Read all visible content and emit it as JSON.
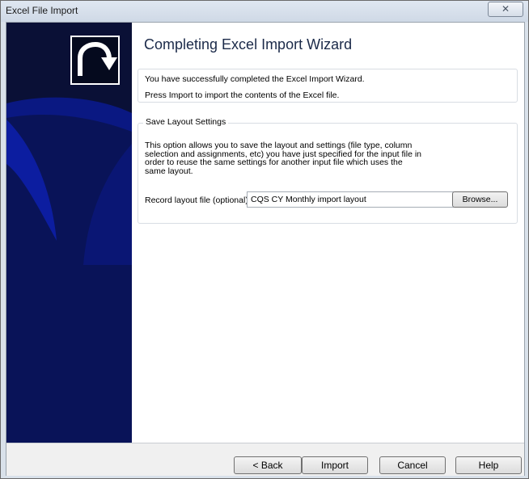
{
  "window": {
    "title": "Excel File Import",
    "close_glyph": "✕"
  },
  "wizard": {
    "heading": "Completing Excel Import Wizard",
    "logo_icon": "curved-arrow-icon",
    "side_panel_color": "#0a1036",
    "accent_color": "#0b1a8f"
  },
  "info": {
    "line1": "You have successfully completed the Excel Import Wizard.",
    "line2": "Press Import to import the contents of the Excel file."
  },
  "layout_settings": {
    "legend": "Save Layout Settings",
    "description": "This option allows you to save the layout and settings (file type, column selection and assignments, etc) you have just specified for the input file in order to reuse the same settings for another input file which uses the same layout.",
    "field_label": "Record layout file (optional):",
    "field_value": "CQS CY Monthly import layout",
    "browse_label": "Browse..."
  },
  "buttons": {
    "back": "< Back",
    "import": "Import",
    "cancel": "Cancel",
    "help": "Help"
  }
}
